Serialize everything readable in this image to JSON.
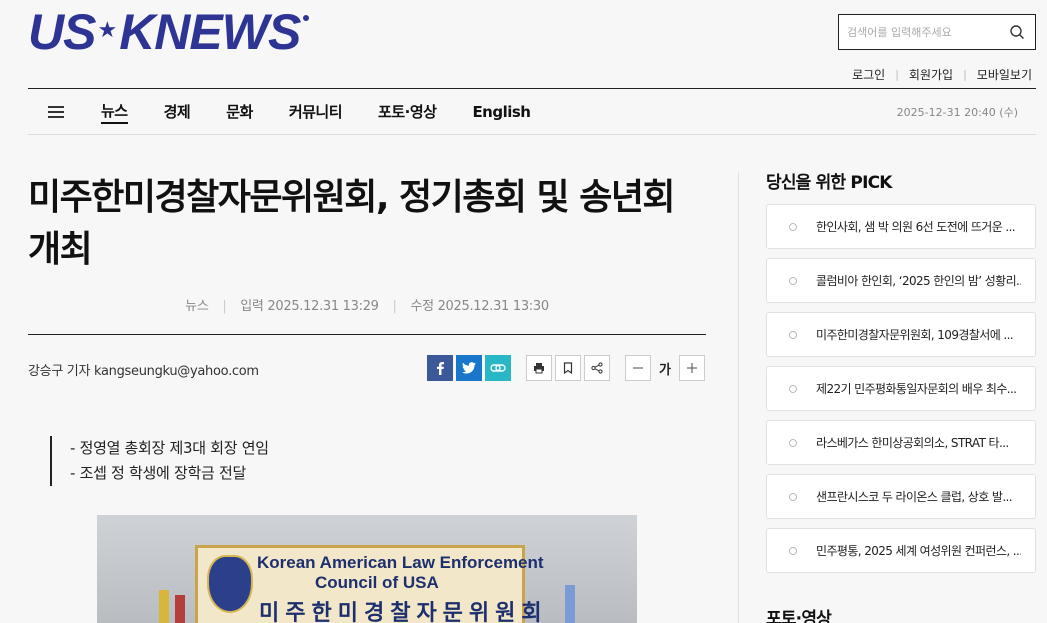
{
  "header": {
    "logo_left": "US",
    "logo_right": "KNEWS",
    "search": {
      "placeholder": "검색어를 입력해주세요"
    },
    "util_links": [
      "로그인",
      "회원가입",
      "모바일보기"
    ]
  },
  "nav": {
    "items": [
      "뉴스",
      "경제",
      "문화",
      "커뮤니티",
      "포토·영상",
      "English"
    ],
    "active": "뉴스",
    "datetime": "2025-12-31 20:40 (수)"
  },
  "article": {
    "title": "미주한미경찰자문위원회, 정기총회 및 송년회 개최",
    "section": "뉴스",
    "published": "입력 2025.12.31 13:29",
    "modified": "수정 2025.12.31 13:30",
    "byline": "강승구 기자 kangseungku@yahoo.com",
    "font_label": "가",
    "summary": [
      "- 정영열 총회장 제3대 회장 연임",
      "- 조셉 정 학생에 장학금 전달"
    ],
    "photo": {
      "banner_line1": "Korean American Law Enforcement",
      "banner_line2": "Council of USA",
      "banner_line3": "미주한미경찰자문위원회"
    }
  },
  "sidebar": {
    "pick_title": "당신을 위한 PICK",
    "pick_items": [
      "한인사회, 샘 박 의원 6선 도전에 뜨거운 ...",
      "콜럼비아 한인회, ‘2025 한인의 밤’ 성황리...",
      "미주한미경찰자문위원회, 109경찰서에 ...",
      "제22기 민주평화통일자문회의 배우 최수...",
      "라스베가스 한미상공회의소, STRAT 타...",
      "샌프란시스코 두 라이온스 클럽, 상호 발...",
      "민주평통, 2025 세계 여성위원 컨퍼런스, ..."
    ],
    "photo_section_title": "포토·영상"
  },
  "colors": {
    "brand": "#2d3494",
    "facebook": "#3b5998",
    "twitter": "#1877c8",
    "link": "#29b7c6"
  }
}
